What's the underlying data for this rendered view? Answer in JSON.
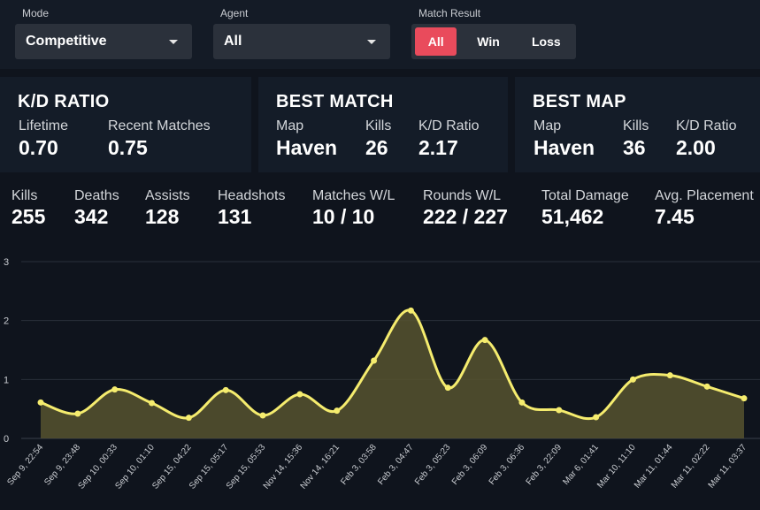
{
  "filters": {
    "mode": {
      "label": "Mode",
      "value": "Competitive"
    },
    "agent": {
      "label": "Agent",
      "value": "All"
    },
    "match_result": {
      "label": "Match Result",
      "options": [
        "All",
        "Win",
        "Loss"
      ],
      "selected": "All"
    }
  },
  "kd_card": {
    "title": "K/D RATIO",
    "lifetime_label": "Lifetime",
    "lifetime_value": "0.70",
    "recent_label": "Recent Matches",
    "recent_value": "0.75"
  },
  "best_match_card": {
    "title": "BEST MATCH",
    "map_label": "Map",
    "map_value": "Haven",
    "kills_label": "Kills",
    "kills_value": "26",
    "kd_label": "K/D Ratio",
    "kd_value": "2.17"
  },
  "best_map_card": {
    "title": "BEST MAP",
    "map_label": "Map",
    "map_value": "Haven",
    "kills_label": "Kills",
    "kills_value": "36",
    "kd_label": "K/D Ratio",
    "kd_value": "2.00"
  },
  "summary": [
    {
      "label": "Kills",
      "value": "255"
    },
    {
      "label": "Deaths",
      "value": "342"
    },
    {
      "label": "Assists",
      "value": "128"
    },
    {
      "label": "Headshots",
      "value": "131"
    },
    {
      "label": "Matches W/L",
      "value": "10 / 10"
    },
    {
      "label": "Rounds W/L",
      "value": "222 / 227"
    },
    {
      "label": "Total Damage",
      "value": "51,462"
    },
    {
      "label": "Avg. Placement",
      "value": "7.45"
    }
  ],
  "colors": {
    "accent": "#e94b5c",
    "line": "#f5ec6e",
    "fill": "#56522f"
  },
  "chart_data": {
    "type": "area",
    "x": [
      "Sep 9, 22:54",
      "Sep 9, 23:48",
      "Sep 10, 00:33",
      "Sep 10, 01:10",
      "Sep 15, 04:22",
      "Sep 15, 05:17",
      "Sep 15, 05:53",
      "Nov 14, 15:36",
      "Nov 14, 16:21",
      "Feb 3, 03:58",
      "Feb 3, 04:47",
      "Feb 3, 05:23",
      "Feb 3, 06:09",
      "Feb 3, 06:36",
      "Feb 3, 22:09",
      "Mar 6, 01:41",
      "Mar 10, 11:10",
      "Mar 11, 01:44",
      "Mar 11, 02:22",
      "Mar 11, 03:37"
    ],
    "series": [
      {
        "values": [
          0.61,
          0.42,
          0.83,
          0.6,
          0.35,
          0.82,
          0.39,
          0.75,
          0.47,
          1.32,
          2.17,
          0.86,
          1.67,
          0.61,
          0.48,
          0.36,
          1.0,
          1.07,
          0.88,
          0.68
        ]
      }
    ],
    "yticks": [
      0,
      1,
      2,
      3
    ],
    "ylim": [
      0,
      3
    ],
    "grid": true
  }
}
